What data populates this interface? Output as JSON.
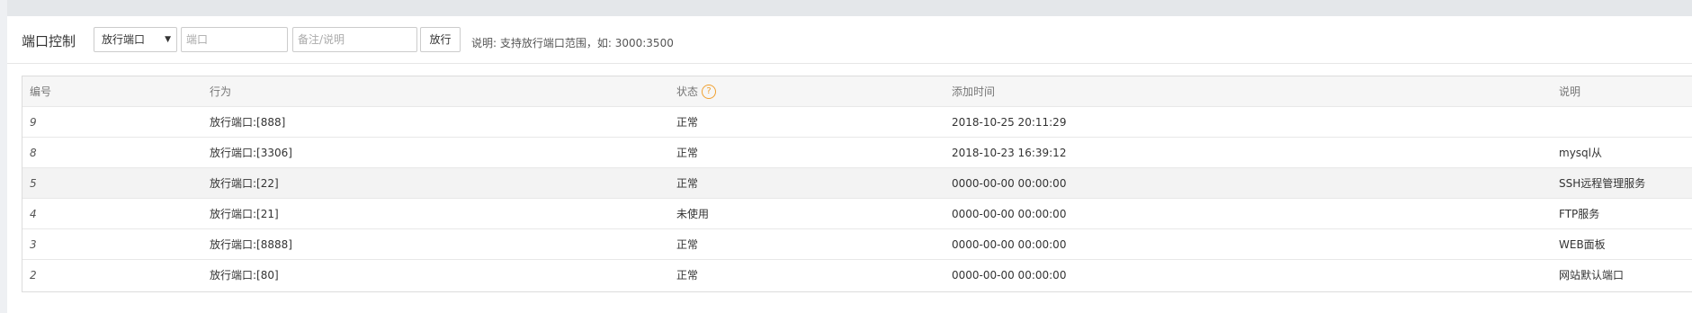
{
  "toolbar": {
    "title": "端口控制",
    "action_select": "放行端口",
    "caret": "▼",
    "port_placeholder": "端口",
    "note_placeholder": "备注/说明",
    "submit_label": "放行",
    "hint": "说明: 支持放行端口范围，如: 3000:3500"
  },
  "table": {
    "headers": {
      "id": "编号",
      "action": "行为",
      "status": "状态",
      "status_help": "?",
      "time": "添加时间",
      "note": "说明"
    },
    "rows": [
      {
        "id": "9",
        "action": "放行端口:[888]",
        "status": "正常",
        "time": "2018-10-25 20:11:29",
        "note": ""
      },
      {
        "id": "8",
        "action": "放行端口:[3306]",
        "status": "正常",
        "time": "2018-10-23 16:39:12",
        "note": "mysql从"
      },
      {
        "id": "5",
        "action": "放行端口:[22]",
        "status": "正常",
        "time": "0000-00-00 00:00:00",
        "note": "SSH远程管理服务"
      },
      {
        "id": "4",
        "action": "放行端口:[21]",
        "status": "未使用",
        "time": "0000-00-00 00:00:00",
        "note": "FTP服务"
      },
      {
        "id": "3",
        "action": "放行端口:[8888]",
        "status": "正常",
        "time": "0000-00-00 00:00:00",
        "note": "WEB面板"
      },
      {
        "id": "2",
        "action": "放行端口:[80]",
        "status": "正常",
        "time": "0000-00-00 00:00:00",
        "note": "网站默认端口"
      }
    ]
  }
}
